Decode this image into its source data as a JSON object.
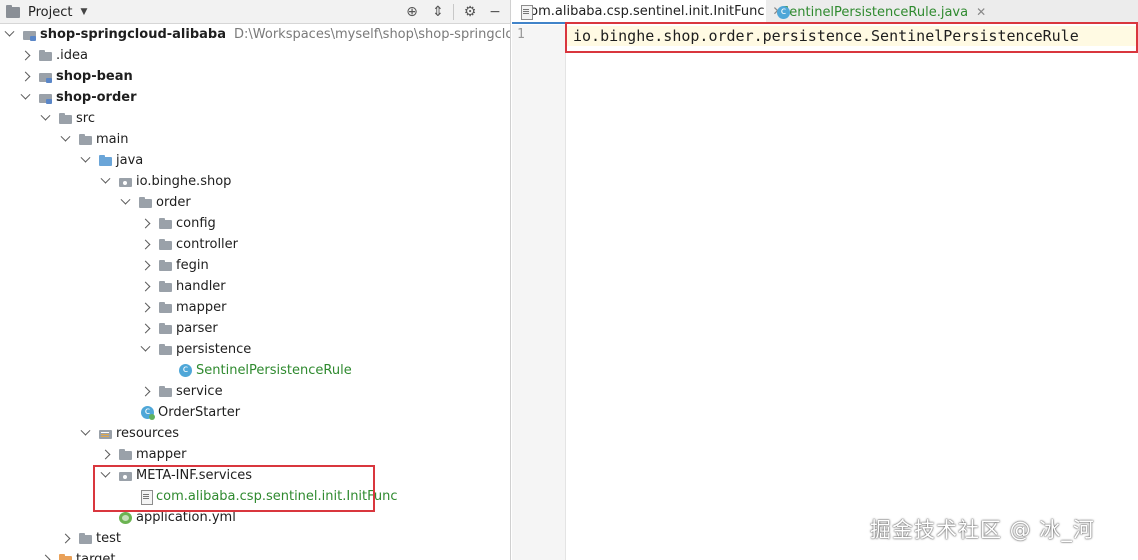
{
  "project_panel": {
    "title": "Project",
    "header_icons": [
      "crosshair-icon",
      "collapse-icon",
      "gear-icon",
      "minimize-icon"
    ],
    "tree": [
      {
        "label": "shop-springcloud-alibaba",
        "path": "D:\\Workspaces\\myself\\shop\\shop-springcloud-alibab",
        "icon": "module-folder-icon",
        "expanded": true
      },
      {
        "label": ".idea",
        "icon": "folder-icon",
        "expanded": false
      },
      {
        "label": "shop-bean",
        "icon": "module-folder-icon",
        "expanded": false
      },
      {
        "label": "shop-order",
        "icon": "module-folder-icon",
        "expanded": true
      },
      {
        "label": "src",
        "icon": "folder-icon",
        "expanded": true
      },
      {
        "label": "main",
        "icon": "folder-icon",
        "expanded": true
      },
      {
        "label": "java",
        "icon": "source-folder-icon",
        "expanded": true
      },
      {
        "label": "io.binghe.shop",
        "icon": "package-icon",
        "expanded": true
      },
      {
        "label": "order",
        "icon": "folder-icon",
        "expanded": true
      },
      {
        "label": "config",
        "icon": "folder-icon",
        "expanded": false
      },
      {
        "label": "controller",
        "icon": "folder-icon",
        "expanded": false
      },
      {
        "label": "fegin",
        "icon": "folder-icon",
        "expanded": false
      },
      {
        "label": "handler",
        "icon": "folder-icon",
        "expanded": false
      },
      {
        "label": "mapper",
        "icon": "folder-icon",
        "expanded": false
      },
      {
        "label": "parser",
        "icon": "folder-icon",
        "expanded": false
      },
      {
        "label": "persistence",
        "icon": "folder-icon",
        "expanded": true
      },
      {
        "label": "SentinelPersistenceRule",
        "icon": "java-class-icon"
      },
      {
        "label": "service",
        "icon": "folder-icon",
        "expanded": false
      },
      {
        "label": "OrderStarter",
        "icon": "spring-main-class-icon"
      },
      {
        "label": "resources",
        "icon": "resources-folder-icon",
        "expanded": true
      },
      {
        "label": "mapper",
        "icon": "folder-icon",
        "expanded": false
      },
      {
        "label": "META-INF.services",
        "icon": "package-icon",
        "expanded": true
      },
      {
        "label": "com.alibaba.csp.sentinel.init.InitFunc",
        "icon": "text-file-icon"
      },
      {
        "label": "application.yml",
        "icon": "spring-yml-icon"
      },
      {
        "label": "test",
        "icon": "folder-icon",
        "expanded": false
      },
      {
        "label": "target",
        "icon": "target-folder-icon",
        "expanded": false
      }
    ]
  },
  "editor": {
    "tabs": [
      {
        "label": "com.alibaba.csp.sentinel.init.InitFunc",
        "active": true,
        "icon": "text-file-icon"
      },
      {
        "label": "SentinelPersistenceRule.java",
        "active": false,
        "icon": "java-class-icon"
      }
    ],
    "line_number": "1",
    "code": "io.binghe.shop.order.persistence.SentinelPersistenceRule"
  },
  "watermark": "掘金技术社区 @ 冰_河",
  "colors": {
    "highlight_box": "#d9363e",
    "green_file_text": "#2f8a2f",
    "current_line": "#fffae3"
  }
}
